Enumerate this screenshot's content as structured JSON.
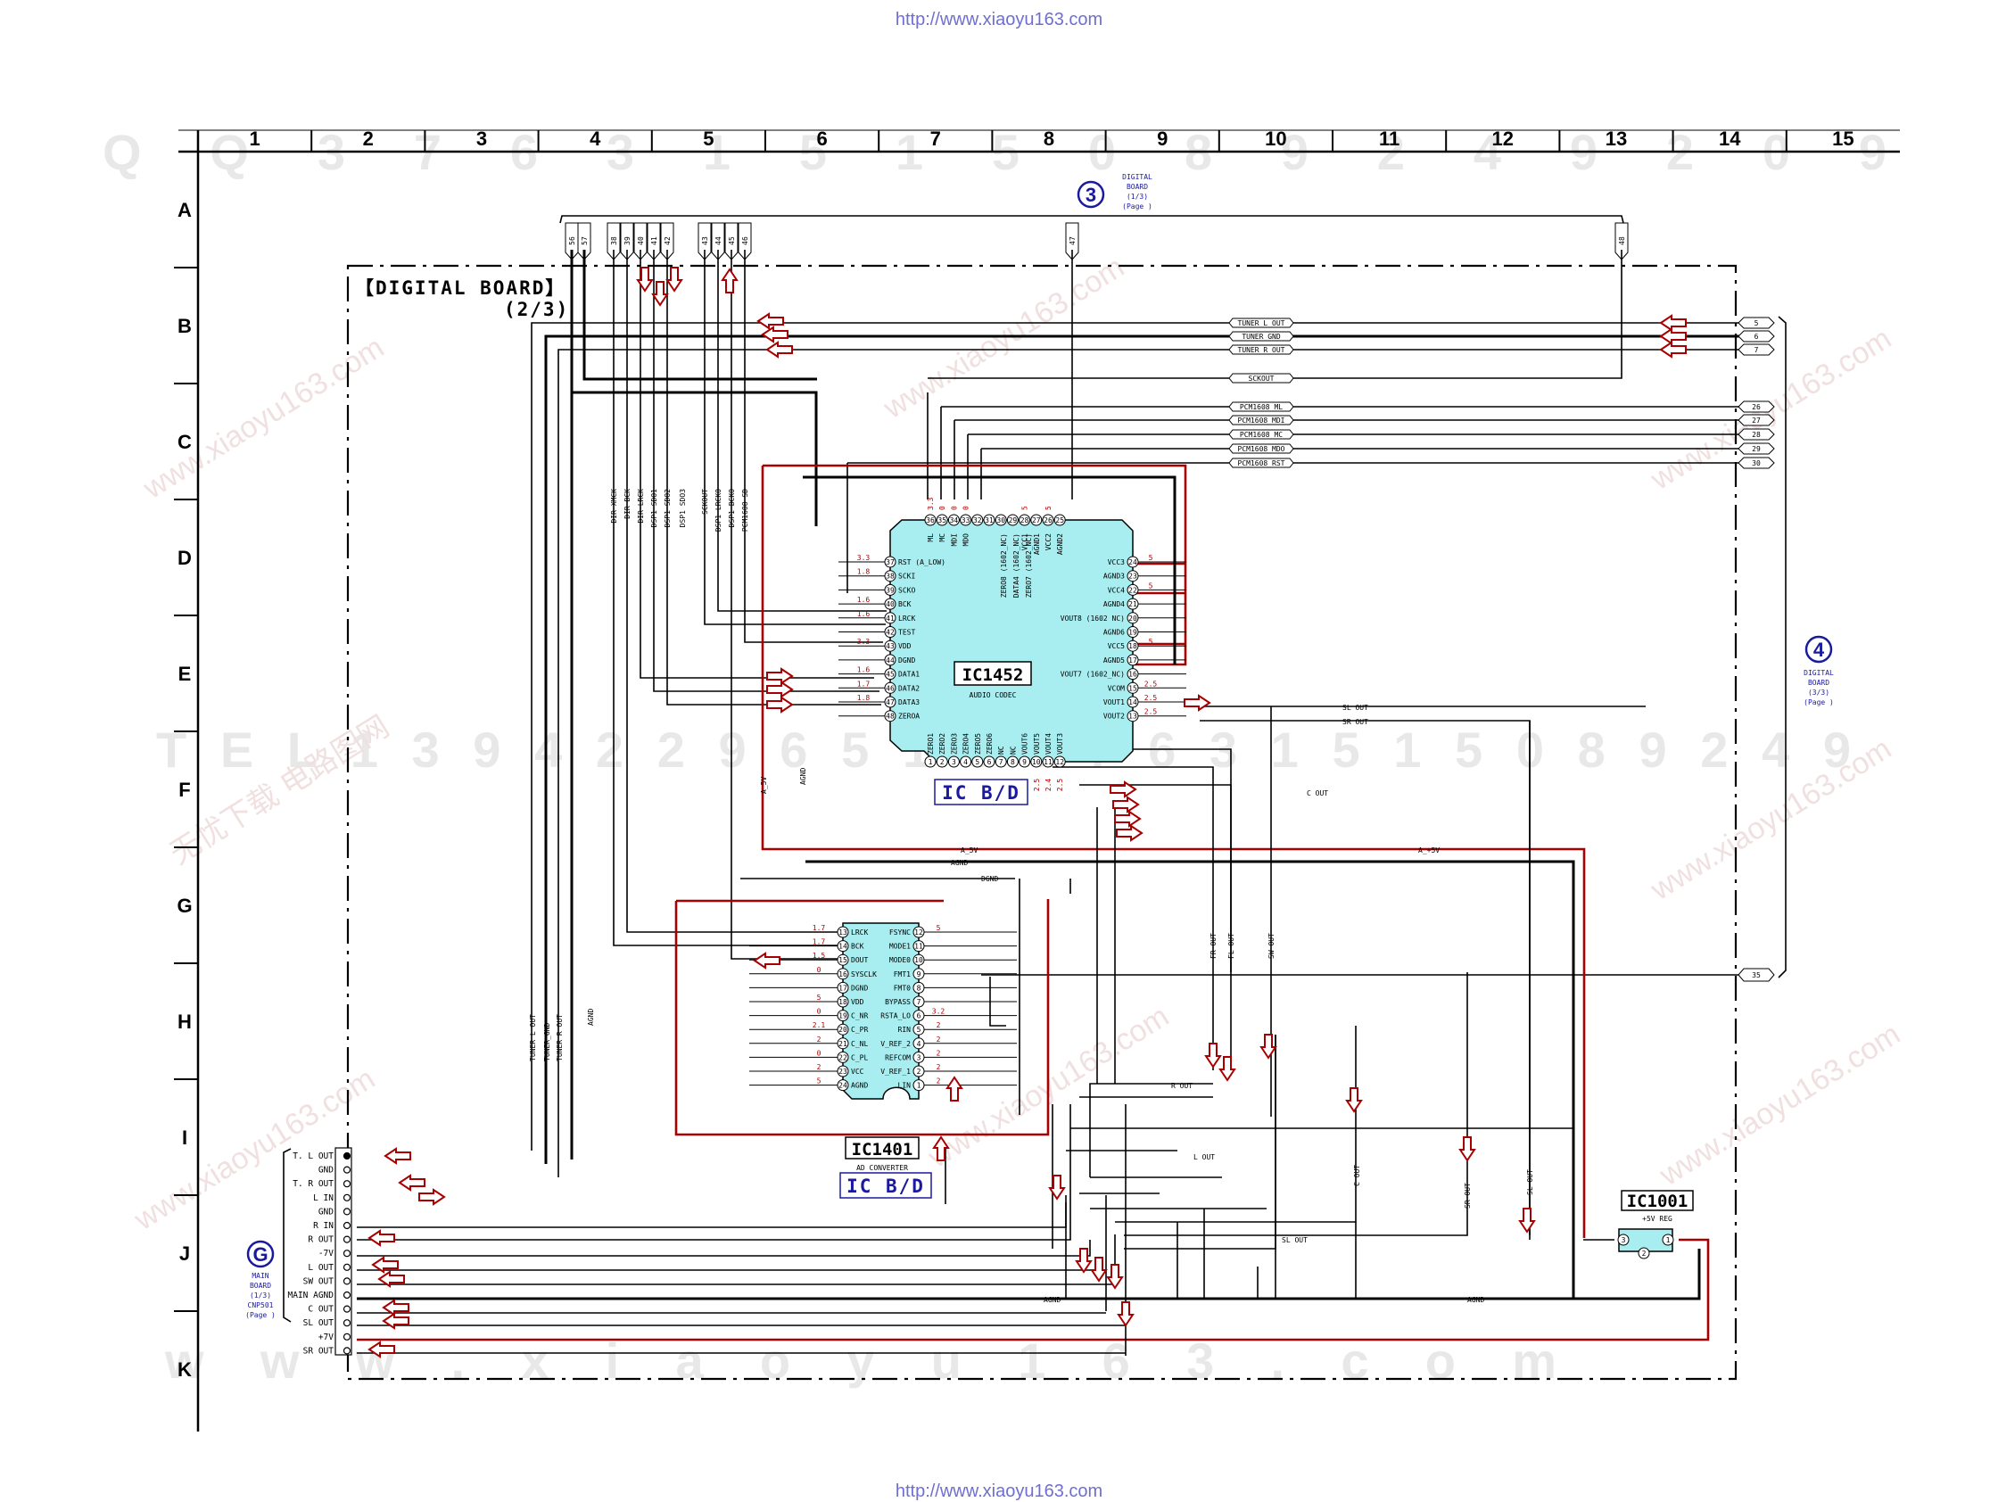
{
  "header_url": "http://www.xiaoyu163.com",
  "footer_url": "http://www.xiaoyu163.com",
  "grid": {
    "columns": [
      "1",
      "2",
      "3",
      "4",
      "5",
      "6",
      "7",
      "8",
      "9",
      "10",
      "11",
      "12",
      "13",
      "14",
      "15"
    ],
    "rows": [
      "A",
      "B",
      "C",
      "D",
      "E",
      "F",
      "G",
      "H",
      "I",
      "J",
      "K"
    ]
  },
  "watermarks": {
    "top_code": "Q Q 3 7 6 3 1 5 1 5 0 8 9 2 4 9 2 0 9",
    "mid_code": "T E L 1 3 9 4 2 2 9 6 5 1 3 9 7 6 3 1 5 1 5 0 8 9 2 4 9",
    "bottom_code": "w w w . x i a o y u 1 6 3 . c o m",
    "site": "www.xiaoyu163.com",
    "cn": "无忧下载 电路图网"
  },
  "board": {
    "title": "【DIGITAL BOARD】",
    "subtitle": "(2/3)"
  },
  "connectors": {
    "ref3": {
      "number": "3",
      "lines": [
        "DIGITAL",
        "BOARD",
        "(1/3)",
        "(Page    )"
      ]
    },
    "ref4": {
      "number": "4",
      "lines": [
        "DIGITAL",
        "BOARD",
        "(3/3)",
        "(Page    )"
      ]
    },
    "refG": {
      "number": "G",
      "lines": [
        "MAIN",
        "BOARD",
        "(1/3)",
        "CNP501",
        "(Page    )"
      ]
    }
  },
  "top_pins": [
    "56",
    "57",
    "38",
    "39",
    "40",
    "41",
    "42",
    "43",
    "44",
    "45",
    "46",
    "47",
    "48"
  ],
  "bus_labels": [
    "DIR XMCK",
    "DIR BCK",
    "DIR LRCK",
    "DSP1 SDO1",
    "DSP1 SDO2",
    "DSP1 SDO3",
    "SCKOUT",
    "DSP1 LRCKO",
    "DSP1 BCKO",
    "PCM1608 SD"
  ],
  "right_signals": [
    {
      "label": "TUNER L OUT",
      "pin": "5"
    },
    {
      "label": "TUNER_GND",
      "pin": "6"
    },
    {
      "label": "TUNER R OUT",
      "pin": "7"
    },
    {
      "label": "SCKOUT",
      "pin": ""
    },
    {
      "label": "PCM1608_ML",
      "pin": "26"
    },
    {
      "label": "PCM1608_MDI",
      "pin": "27"
    },
    {
      "label": "PCM1608_MC",
      "pin": "28"
    },
    {
      "label": "PCM1608_MDO",
      "pin": "29"
    },
    {
      "label": "PCM1608_RST",
      "pin": "30"
    }
  ],
  "pin35": "35",
  "ic1452": {
    "name": "IC1452",
    "desc": "AUDIO CODEC",
    "tag": "IC B/D",
    "top_pins": [
      "36",
      "35",
      "34",
      "33",
      "32",
      "31",
      "30",
      "29",
      "28",
      "27",
      "26",
      "25"
    ],
    "top_names": [
      "ML",
      "MC",
      "MDI",
      "MDO",
      "",
      "",
      "",
      "",
      "VCC1",
      "AGND1",
      "VCC2",
      "AGND2"
    ],
    "top_volts": [
      "3.3",
      "0",
      "0",
      "0",
      "",
      "",
      "",
      "",
      "5",
      "",
      "5",
      ""
    ],
    "left": [
      {
        "pin": "37",
        "name": "RST (A_LOW)",
        "v": "3.3"
      },
      {
        "pin": "38",
        "name": "SCKI",
        "v": "1.8"
      },
      {
        "pin": "39",
        "name": "SCKO",
        "v": ""
      },
      {
        "pin": "40",
        "name": "BCK",
        "v": "1.6"
      },
      {
        "pin": "41",
        "name": "LRCK",
        "v": "1.6"
      },
      {
        "pin": "42",
        "name": "TEST",
        "v": ""
      },
      {
        "pin": "43",
        "name": "VDD",
        "v": "3.3"
      },
      {
        "pin": "44",
        "name": "DGND",
        "v": ""
      },
      {
        "pin": "45",
        "name": "DATA1",
        "v": "1.6"
      },
      {
        "pin": "46",
        "name": "DATA2",
        "v": "1.7"
      },
      {
        "pin": "47",
        "name": "DATA3",
        "v": "1.8"
      },
      {
        "pin": "48",
        "name": "ZEROA",
        "v": ""
      }
    ],
    "right": [
      {
        "pin": "24",
        "name": "VCC3",
        "v": "5"
      },
      {
        "pin": "23",
        "name": "AGND3",
        "v": ""
      },
      {
        "pin": "22",
        "name": "VCC4",
        "v": "5"
      },
      {
        "pin": "21",
        "name": "AGND4",
        "v": ""
      },
      {
        "pin": "20",
        "name": "VOUT8 (1602 NC)",
        "v": ""
      },
      {
        "pin": "19",
        "name": "AGND6",
        "v": ""
      },
      {
        "pin": "18",
        "name": "VCC5",
        "v": "5"
      },
      {
        "pin": "17",
        "name": "AGND5",
        "v": ""
      },
      {
        "pin": "16",
        "name": "VOUT7 (1602_NC)",
        "v": ""
      },
      {
        "pin": "15",
        "name": "VCOM",
        "v": "2.5"
      },
      {
        "pin": "14",
        "name": "VOUT1",
        "v": "2.5"
      },
      {
        "pin": "13",
        "name": "VOUT2",
        "v": "2.5"
      }
    ],
    "bottom_pins": [
      "1",
      "2",
      "3",
      "4",
      "5",
      "6",
      "7",
      "8",
      "9",
      "10",
      "11",
      "12"
    ],
    "bottom_names": [
      "ZERO1",
      "ZERO2",
      "ZERO3",
      "ZERO4",
      "ZERO5",
      "ZERO6",
      "NC",
      "NC",
      "VOUT6",
      "VOUT5",
      "VOUT4",
      "VOUT3"
    ],
    "bottom_volts": [
      "",
      "",
      "",
      "",
      "",
      "",
      "",
      "",
      "0",
      "2.5",
      "2.4",
      "2.5"
    ],
    "inner_labels": [
      "ZERO8 (1602_NC)",
      "DATA4 (1602_NC)",
      "ZERO7 (1602_NC)"
    ]
  },
  "ic1401": {
    "name": "IC1401",
    "desc": "AD CONVERTER",
    "tag": "IC B/D",
    "left": [
      {
        "pin": "13",
        "name": "LRCK",
        "v": "1.7"
      },
      {
        "pin": "14",
        "name": "BCK",
        "v": "1.7"
      },
      {
        "pin": "15",
        "name": "DOUT",
        "v": "1.5"
      },
      {
        "pin": "16",
        "name": "SYSCLK",
        "v": "0"
      },
      {
        "pin": "17",
        "name": "DGND",
        "v": ""
      },
      {
        "pin": "18",
        "name": "VDD",
        "v": "5"
      },
      {
        "pin": "19",
        "name": "C_NR",
        "v": "0"
      },
      {
        "pin": "20",
        "name": "C_PR",
        "v": "2.1"
      },
      {
        "pin": "21",
        "name": "C_NL",
        "v": "2"
      },
      {
        "pin": "22",
        "name": "C_PL",
        "v": "0"
      },
      {
        "pin": "23",
        "name": "VCC",
        "v": "2"
      },
      {
        "pin": "24",
        "name": "AGND",
        "v": "5"
      }
    ],
    "right": [
      {
        "pin": "12",
        "name": "FSYNC",
        "v": "5"
      },
      {
        "pin": "11",
        "name": "MODE1",
        "v": ""
      },
      {
        "pin": "10",
        "name": "MODE0",
        "v": ""
      },
      {
        "pin": "9",
        "name": "FMT1",
        "v": ""
      },
      {
        "pin": "8",
        "name": "FMT0",
        "v": ""
      },
      {
        "pin": "7",
        "name": "BYPASS",
        "v": ""
      },
      {
        "pin": "6",
        "name": "RSTA_LO",
        "v": "3.2"
      },
      {
        "pin": "5",
        "name": "RIN",
        "v": "2"
      },
      {
        "pin": "4",
        "name": "V_REF_2",
        "v": "2"
      },
      {
        "pin": "3",
        "name": "REFCOM",
        "v": "2"
      },
      {
        "pin": "2",
        "name": "V_REF_1",
        "v": "2"
      },
      {
        "pin": "1",
        "name": "LIN",
        "v": "2"
      }
    ]
  },
  "ic1001": {
    "name": "IC1001",
    "desc": "+5V REG",
    "pins": [
      "3",
      "2",
      "1"
    ]
  },
  "left_connector": [
    "T. L OUT",
    "GND",
    "T. R OUT",
    "L IN",
    "GND",
    "R IN",
    "R OUT",
    "-7V",
    "L OUT",
    "SW OUT",
    "MAIN AGND",
    "C OUT",
    "SL OUT",
    "+7V",
    "SR OUT"
  ],
  "nets": {
    "a5v": "A_5V",
    "aplus5v": "A_+5V",
    "agnd": "AGND",
    "dgnd": "DGND",
    "sl_out": "SL OUT",
    "sr_out": "SR OUT",
    "c_out": "C OUT",
    "fr_out": "FR OUT",
    "fl_out": "FL OUT",
    "sw_out": "SW OUT",
    "r_out": "R OUT",
    "l_out": "L OUT",
    "tuner_l": "TUNER L OUT",
    "tuner_gnd": "TUNER_GND",
    "tuner_r": "TUNER R OUT",
    "a_5v_v": "A_5V",
    "agnd_v": "AGND"
  },
  "colors": {
    "power": "#a80000",
    "ic_fill": "#a8eef0",
    "link_blue": "#1a1aa0"
  }
}
